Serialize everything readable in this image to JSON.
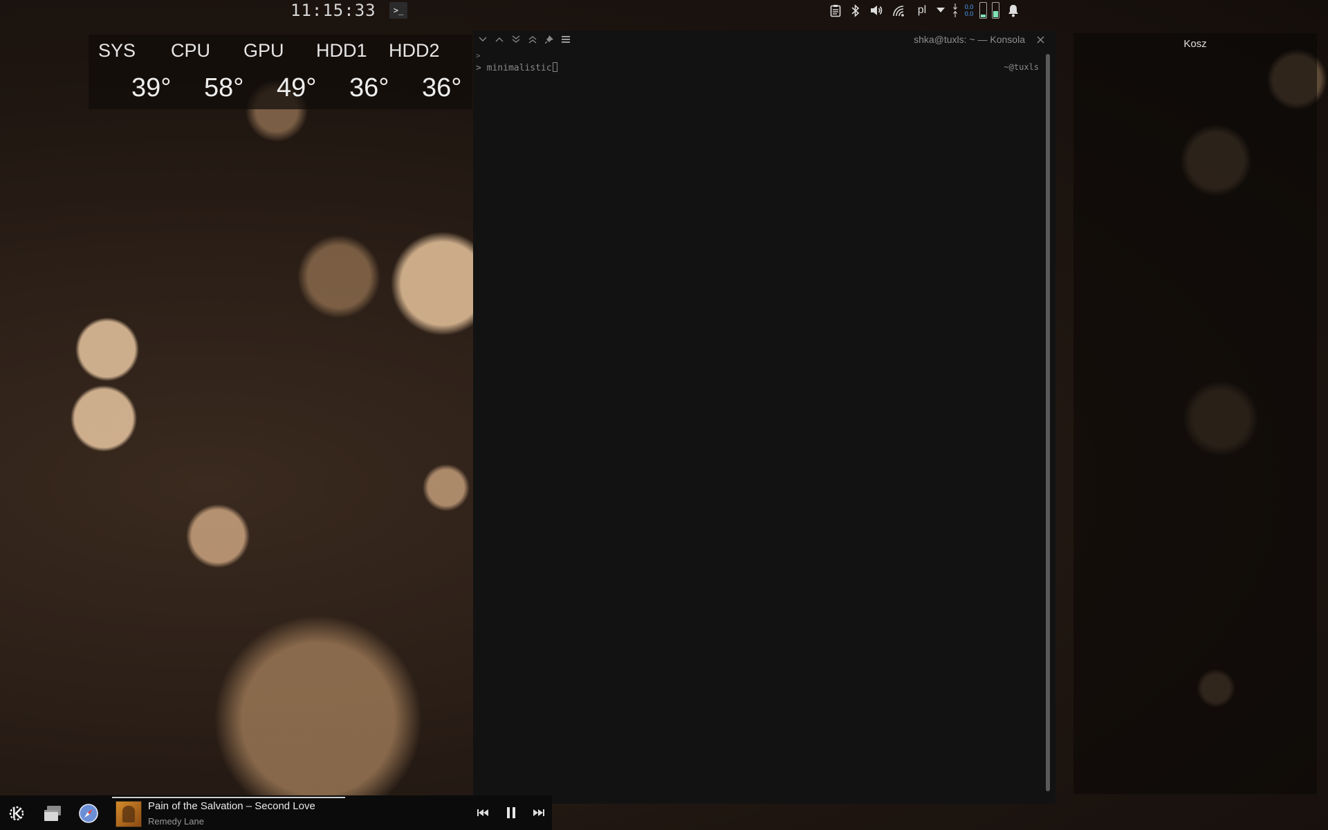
{
  "topbar": {
    "clock": "11:15:33",
    "terminal_launcher": ">_",
    "tray": {
      "language": "pl",
      "net_down": "0.0",
      "net_up": "0.0",
      "battery1_level": 0.2,
      "battery2_level": 0.45
    }
  },
  "sensors": [
    {
      "name": "SYS",
      "value": "39°"
    },
    {
      "name": "CPU",
      "value": "58°"
    },
    {
      "name": "GPU",
      "value": "49°"
    },
    {
      "name": "HDD1",
      "value": "36°"
    },
    {
      "name": "HDD2",
      "value": "36°"
    }
  ],
  "konsola": {
    "title": "shka@tuxls: ~ — Konsola",
    "prompt_arrow": ">",
    "prompt_line": "> minimalistic",
    "right_prompt": "~@tuxls"
  },
  "kosz": {
    "title": "Kosz"
  },
  "bottombar": {
    "player": {
      "track": "Pain of the Salvation – Second Love",
      "album": "Remedy Lane",
      "progress": 0.53
    }
  },
  "colors": {
    "accent_blue": "#4aa3ff",
    "battery_green": "#7fe3b4",
    "terminal_bg": "#121212"
  },
  "icons": [
    "kde-logo-icon",
    "window-switcher-icon",
    "compass-icon",
    "clipboard-icon",
    "bluetooth-icon",
    "volume-icon",
    "wifi-icon",
    "chevron-down-icon",
    "bell-icon"
  ]
}
